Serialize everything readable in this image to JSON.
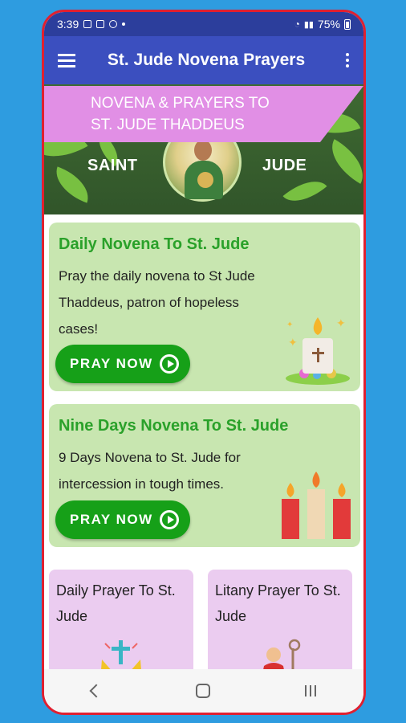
{
  "status_bar": {
    "time": "3:39",
    "battery_percent": "75%"
  },
  "app_bar": {
    "title": "St. Jude Novena Prayers",
    "menu_icon": "hamburger-icon",
    "overflow_icon": "more-vert-icon"
  },
  "banner": {
    "ribbon_line1": "NOVENA & PRAYERS TO",
    "ribbon_line2": "ST. JUDE THADDEUS",
    "word_left": "SAINT",
    "word_right": "JUDE"
  },
  "cards": [
    {
      "title": "Daily Novena To St. Jude",
      "description": "Pray the daily novena to St Jude Thaddeus, patron of hopeless cases!",
      "button_label": "PRAY NOW",
      "illustration": "candle-icon"
    },
    {
      "title": "Nine Days Novena To St. Jude",
      "description": "9 Days Novena to St. Jude for intercession in tough times.",
      "button_label": "PRAY NOW",
      "illustration": "three-candles-icon"
    }
  ],
  "small_cards": [
    {
      "title": "Daily Prayer To St. Jude",
      "illustration": "praying-hands-cross-icon"
    },
    {
      "title": "Litany Prayer To St. Jude",
      "illustration": "saint-figure-icon"
    }
  ],
  "colors": {
    "status_bar": "#2c3e9c",
    "app_bar": "#3b4fbf",
    "card_green": "#c8e6b0",
    "title_green": "#2aa12a",
    "button_green": "#16a018",
    "card_pink": "#ebccf0",
    "ribbon": "#e18fe5"
  }
}
